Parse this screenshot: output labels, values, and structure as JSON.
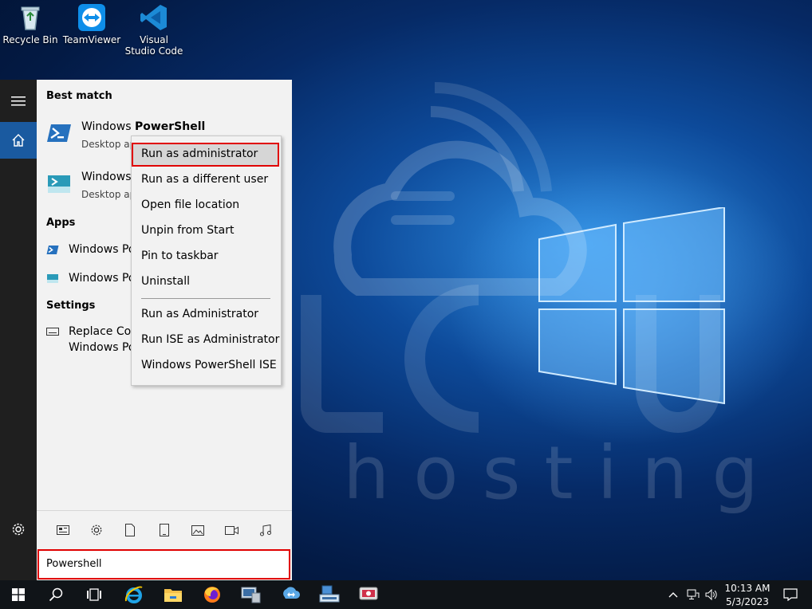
{
  "desktop": {
    "icons": [
      {
        "label": "Recycle Bin",
        "icon": "recycle-bin-icon"
      },
      {
        "label": "TeamViewer",
        "icon": "teamviewer-icon"
      },
      {
        "label": "Visual Studio Code",
        "icon": "vscode-icon"
      }
    ],
    "watermark": "hosting",
    "colors": {
      "background_dark": "#031a44",
      "background_light": "#2d8ce0"
    }
  },
  "start_rail": {
    "items": [
      {
        "icon": "hamburger-menu-icon"
      },
      {
        "icon": "home-icon"
      },
      {
        "icon": "settings-gear-icon"
      }
    ]
  },
  "start_menu": {
    "best_match_heading": "Best match",
    "best_match": [
      {
        "title_prefix": "Windows ",
        "title_bold": "PowerShell",
        "subtitle": "Desktop ap"
      },
      {
        "title_prefix": "Windows",
        "title_bold": "",
        "subtitle": "Desktop ap"
      }
    ],
    "apps_heading": "Apps",
    "apps": [
      {
        "title": "Windows Po"
      },
      {
        "title": "Windows Po"
      }
    ],
    "settings_heading": "Settings",
    "settings": [
      {
        "line1": "Replace Cor",
        "line2": "Windows Po"
      }
    ],
    "quick_filters": [
      "news-icon",
      "gear-icon",
      "document-icon",
      "tablet-icon",
      "image-icon",
      "video-icon",
      "music-icon"
    ]
  },
  "context_menu": {
    "items": [
      "Run as administrator",
      "Run as a different user",
      "Open file location",
      "Unpin from Start",
      "Pin to taskbar",
      "Uninstall",
      "Run as Administrator",
      "Run ISE as Administrator",
      "Windows PowerShell ISE"
    ],
    "highlight_color": "#e00000"
  },
  "search": {
    "value": "Powershell"
  },
  "taskbar": {
    "icons": [
      "windows-start-icon",
      "search-icon",
      "task-view-icon",
      "internet-explorer-icon",
      "file-explorer-icon",
      "firefox-icon",
      "server-manager-icon",
      "teamviewer-icon",
      "remote-tool-icon",
      "remote-desktop-icon"
    ],
    "clock_time": "10:13 AM",
    "clock_date": "5/3/2023"
  }
}
